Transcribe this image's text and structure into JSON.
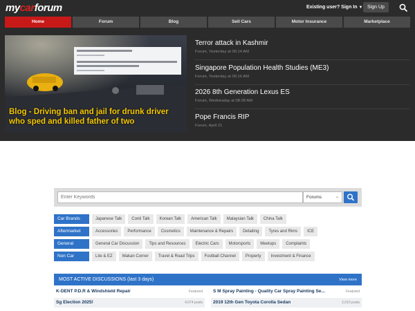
{
  "header": {
    "logo": {
      "my": "my",
      "car": "car",
      "forum": "forum"
    },
    "signin_label": "Existing user? Sign In",
    "signup_label": "Sign Up"
  },
  "nav": [
    {
      "label": "Home",
      "active": true
    },
    {
      "label": "Forum"
    },
    {
      "label": "Blog"
    },
    {
      "label": "Sell Cars"
    },
    {
      "label": "Motor Insurance"
    },
    {
      "label": "Marketplace"
    }
  ],
  "hero": {
    "caption": "Blog - Driving ban and jail for drunk driver who sped and killed father of two"
  },
  "articles": [
    {
      "title": "Terror attack in Kashmir",
      "meta": "Forum, Yesterday at 06:14 AM"
    },
    {
      "title": "Singapore Population Health Studies (ME3)",
      "meta": "Forum, Yesterday at 05:16 AM"
    },
    {
      "title": "2026 8th Generation Lexus ES",
      "meta": "Forum, Wednesday at 08:28 AM"
    },
    {
      "title": "Pope Francis RIP",
      "meta": "Forum, April 21"
    }
  ],
  "search": {
    "placeholder": "Enter Keywords",
    "scope": "Forums"
  },
  "categories": [
    {
      "head": "Car Brands",
      "links": [
        "Japanese Talk",
        "Conti Talk",
        "Korean Talk",
        "American Talk",
        "Malaysian Talk",
        "China Talk"
      ]
    },
    {
      "head": "Aftermarket",
      "links": [
        "Accessories",
        "Performance",
        "Cosmetics",
        "Maintenance & Repairs",
        "Detailing",
        "Tyres and Rims",
        "ICE"
      ]
    },
    {
      "head": "General",
      "links": [
        "General Car Discussion",
        "Tips and Resources",
        "Electric Cars",
        "Motorsports",
        "Meetups",
        "Complaints"
      ]
    },
    {
      "head": "Non Car",
      "links": [
        "Lite & EZ",
        "Makan Corner",
        "Travel & Road Trips",
        "Football Channel",
        "Property",
        "Investment & Finance"
      ]
    }
  ],
  "most_active": {
    "title": "MOST ACTIVE DISCUSSIONS (last 3 days)",
    "more": "View more",
    "items": [
      {
        "title": "K-DENT P.D.R & Windshield Repair",
        "meta": "Featured"
      },
      {
        "title": "S M Spray Painting - Quality Car Spray Painting Se...",
        "meta": "Featured"
      },
      {
        "title": "Sg Election 2025!",
        "meta": "4,074 posts"
      },
      {
        "title": "2019 12th Gen Toyota Corolla Sedan",
        "meta": "2,010 posts"
      }
    ]
  },
  "colors": {
    "accent": "#2f73c8",
    "brand_red": "#c81919",
    "caption_yellow": "#f5c800"
  }
}
